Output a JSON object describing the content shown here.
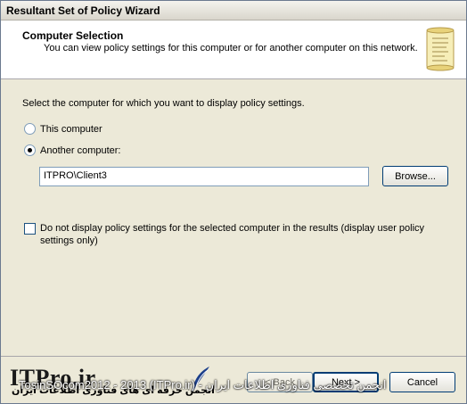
{
  "window": {
    "title": "Resultant Set of Policy Wizard"
  },
  "header": {
    "title": "Computer Selection",
    "subtitle": "You can view policy settings for this computer or for another computer on this network."
  },
  "content": {
    "instruction": "Select the computer for which you want to display policy settings.",
    "option_this_computer": "This computer",
    "option_another_computer": "Another computer:",
    "selected_option": "another",
    "computer_name_value": "ITPRO\\Client3",
    "browse_label": "Browse...",
    "checkbox_label": "Do not display policy settings for the selected computer in the results (display user policy settings only)",
    "checkbox_checked": false
  },
  "footer": {
    "back_label": "< Back",
    "next_label": "Next >",
    "cancel_label": "Cancel"
  },
  "watermark": {
    "brand": "ITPro.ir",
    "arabic_text": "انجمن حرفه ای های فناوری اطلاعات ایران",
    "caption": "TosinSOcom2012 - 2013 (ITPro.ir) - انجمن تخصصی فناوری اطلاعات ایران"
  }
}
